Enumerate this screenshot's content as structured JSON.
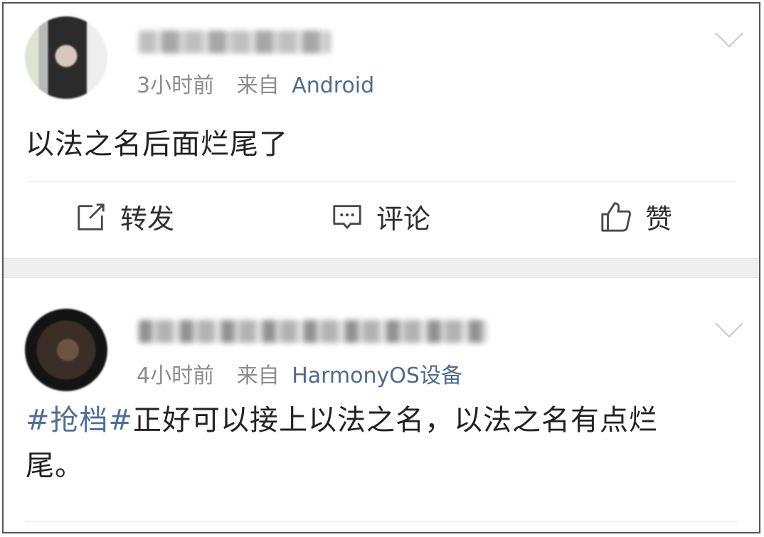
{
  "posts": [
    {
      "time": "3小时前",
      "from_label": "来自",
      "device": "Android",
      "text": "以法之名后面烂尾了",
      "actions": {
        "repost": "转发",
        "comment": "评论",
        "like": "赞"
      }
    },
    {
      "time": "4小时前",
      "from_label": "来自",
      "device": "HarmonyOS设备",
      "hashtag": "#抢档#",
      "text": "正好可以接上以法之名，以法之名有点烂尾。"
    }
  ],
  "colors": {
    "link": "#4f6b8c",
    "muted": "#8c8c8c",
    "text": "#222222",
    "separator": "#efefef"
  },
  "icons": [
    "repost-icon",
    "comment-icon",
    "like-icon",
    "chevron-down-icon"
  ]
}
